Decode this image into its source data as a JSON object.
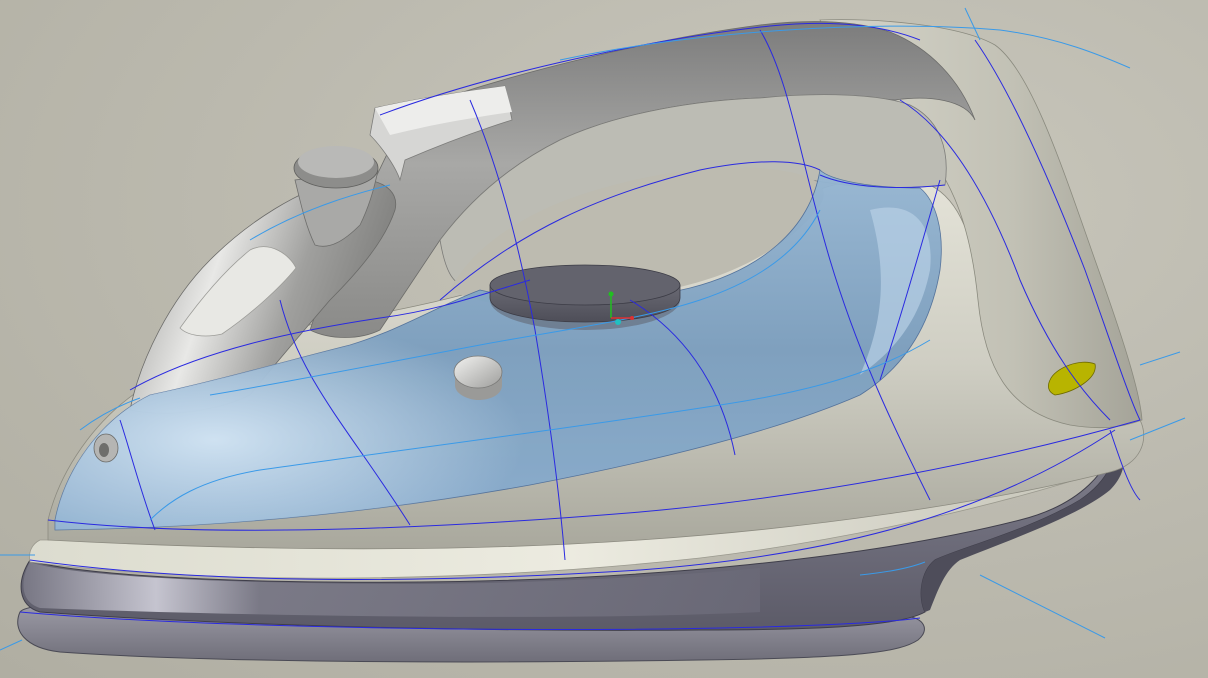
{
  "viewport": {
    "background_color": "#bdbbb0"
  },
  "model": {
    "body_color": "#c8c7bb",
    "handle_color": "#9a9a9a",
    "tank_color": "#7fa3c2",
    "base_color": "#6e6d7c",
    "soleplate_color": "#8a8994",
    "indicator_color": "#b8b400",
    "curve_color_primary": "#2a2ae0",
    "curve_color_secondary": "#3a9ae8"
  },
  "triad": {
    "axis_x_color": "#e03030",
    "axis_y_color": "#20c020",
    "axis_z_color": "#20c0c0"
  }
}
